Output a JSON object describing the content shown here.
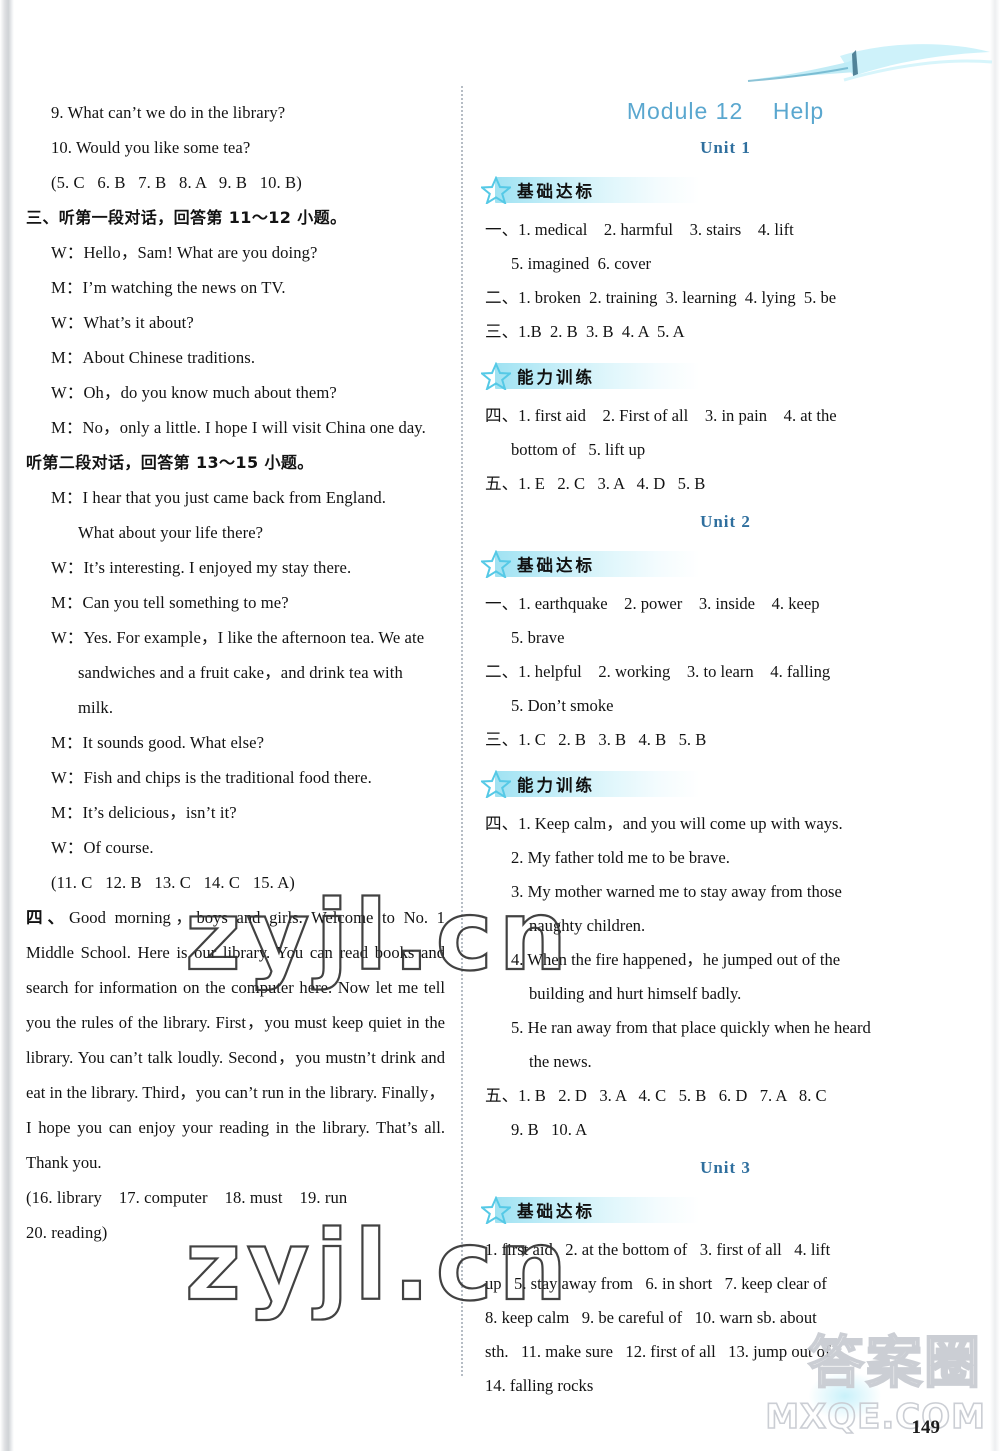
{
  "page": {
    "number": "149",
    "watermarks": {
      "site_outline": "zyjl.cn",
      "brand_cn": "答案圈",
      "brand_domain": "MXQE.COM"
    }
  },
  "left_column": {
    "lines": [
      {
        "id": "l1",
        "indent": 1,
        "text": "9. What can’t we do in the library?"
      },
      {
        "id": "l2",
        "indent": 1,
        "text": "10. Would you like some tea?"
      },
      {
        "id": "l3",
        "indent": 1,
        "text": "(5. C   6. B   7. B   8. A   9. B   10. B)"
      },
      {
        "id": "l4",
        "indent": 0,
        "text": "三、听第一段对话，回答第 11～12 小题。",
        "cn": true
      },
      {
        "id": "l5",
        "indent": 1,
        "text": "W：Hello，Sam! What are you doing?"
      },
      {
        "id": "l6",
        "indent": 1,
        "text": "M：I’m watching the news on TV."
      },
      {
        "id": "l7",
        "indent": 1,
        "text": "W：What’s it about?"
      },
      {
        "id": "l8",
        "indent": 1,
        "text": "M：About Chinese traditions."
      },
      {
        "id": "l9",
        "indent": 1,
        "text": "W：Oh，do you know much about them?"
      },
      {
        "id": "l10",
        "indent": 1,
        "text": "M：No，only a little. I hope I will visit China one day."
      },
      {
        "id": "l11",
        "indent": 0,
        "text": "听第二段对话，回答第 13～15 小题。",
        "cn": true
      },
      {
        "id": "l12",
        "indent": 1,
        "text": "M：I hear that you just came back from England."
      },
      {
        "id": "l13",
        "indent": 2,
        "text": "What about your life there?"
      },
      {
        "id": "l14",
        "indent": 1,
        "text": "W：It’s interesting. I enjoyed my stay there."
      },
      {
        "id": "l15",
        "indent": 1,
        "text": "M：Can you tell something to me?"
      },
      {
        "id": "l16",
        "indent": 1,
        "text": "W：Yes. For example，I like the afternoon tea. We ate"
      },
      {
        "id": "l17",
        "indent": 2,
        "text": "sandwiches and a fruit cake，and drink tea with"
      },
      {
        "id": "l18",
        "indent": 2,
        "text": "milk."
      },
      {
        "id": "l19",
        "indent": 1,
        "text": "M：It sounds good. What else?"
      },
      {
        "id": "l20",
        "indent": 1,
        "text": "W：Fish and chips is the traditional food there."
      },
      {
        "id": "l21",
        "indent": 1,
        "text": "M：It’s delicious，isn’t it?"
      },
      {
        "id": "l22",
        "indent": 1,
        "text": "W：Of course."
      },
      {
        "id": "l23",
        "indent": 1,
        "text": "(11. C   12. B   13. C   14. C   15. A)"
      }
    ],
    "paragraph_lead": "四、",
    "paragraph_text": "Good morning，boys and girls. Welcome to No. 1 Middle School. Here is our library. You can read books and search for information on the computer here. Now let me tell you the rules of the library. First，you must keep quiet in the library. You can’t talk loudly. Second，you mustn’t drink and eat in the library. Third，you can’t run in the library. Finally，I hope you can enjoy your reading in the library. That’s all. Thank you.",
    "answer_lines": [
      {
        "id": "a1",
        "text": "(16. library    17. computer    18. must    19. run"
      },
      {
        "id": "a2",
        "text": "20. reading)"
      }
    ]
  },
  "right_column": {
    "module_title": "Module 12    Help",
    "badges": {
      "basic": "基础达标",
      "ability": "能力训练"
    },
    "units": [
      {
        "id": "unit-1",
        "title": "Unit 1",
        "sections": [
          {
            "badge": "基础达标",
            "badge_kind": "basic",
            "lines": [
              {
                "id": "u1b1",
                "text": "一、1. medical    2. harmful    3. stairs    4. lift",
                "hang": false
              },
              {
                "id": "u1b2",
                "text": "5. imagined  6. cover",
                "hang": true
              },
              {
                "id": "u1b3",
                "text": "二、1. broken  2. training  3. learning  4. lying  5. be",
                "hang": false
              },
              {
                "id": "u1b4",
                "text": "三、1.B  2. B  3. B  4. A  5. A",
                "hang": false
              }
            ]
          },
          {
            "badge": "能力训练",
            "badge_kind": "ability",
            "lines": [
              {
                "id": "u1a1",
                "text": "四、1. first aid    2. First of all    3. in pain    4. at the",
                "hang": false,
                "spread": true
              },
              {
                "id": "u1a2",
                "text": "bottom of   5. lift up",
                "hang": true
              },
              {
                "id": "u1a3",
                "text": "五、1. E   2. C   3. A   4. D   5. B",
                "hang": false
              }
            ]
          }
        ]
      },
      {
        "id": "unit-2",
        "title": "Unit 2",
        "sections": [
          {
            "badge": "基础达标",
            "badge_kind": "basic",
            "lines": [
              {
                "id": "u2b1",
                "text": "一、1. earthquake    2. power    3. inside    4. keep",
                "hang": false
              },
              {
                "id": "u2b2",
                "text": "5. brave",
                "hang": true
              },
              {
                "id": "u2b3",
                "text": "二、1. helpful    2. working    3. to learn    4. falling",
                "hang": false
              },
              {
                "id": "u2b4",
                "text": "5. Don’t smoke",
                "hang": true
              },
              {
                "id": "u2b5",
                "text": "三、1. C   2. B   3. B   4. B   5. B",
                "hang": false
              }
            ]
          },
          {
            "badge": "能力训练",
            "badge_kind": "ability",
            "lines": [
              {
                "id": "u2a1",
                "text": "四、1. Keep calm，and you will come up with ways.",
                "hang": false
              },
              {
                "id": "u2a2",
                "text": "2. My father told me to be brave.",
                "hang": true
              },
              {
                "id": "u2a3",
                "text": "3. My mother warned me to stay away from those",
                "hang": true,
                "spread": true
              },
              {
                "id": "u2a4",
                "text": "naughty children.",
                "hang": true,
                "extra_indent": true
              },
              {
                "id": "u2a5",
                "text": "4. When the fire happened，he jumped out of the",
                "hang": true,
                "spread": true
              },
              {
                "id": "u2a6",
                "text": "building and hurt himself badly.",
                "hang": true,
                "extra_indent": true
              },
              {
                "id": "u2a7",
                "text": "5. He ran away from that place quickly when he heard",
                "hang": true,
                "spread": true
              },
              {
                "id": "u2a8",
                "text": "the news.",
                "hang": true,
                "extra_indent": true
              },
              {
                "id": "u2a9",
                "text": "五、1. B   2. D   3. A   4. C   5. B   6. D   7. A   8. C",
                "hang": false
              },
              {
                "id": "u2a10",
                "text": "9. B   10. A",
                "hang": true
              }
            ]
          }
        ]
      },
      {
        "id": "unit-3",
        "title": "Unit 3",
        "sections": [
          {
            "badge": "基础达标",
            "badge_kind": "basic",
            "lines": [
              {
                "id": "u3b1",
                "text": "1. first aid   2. at the bottom of   3. first of all   4. lift",
                "hang": false,
                "spread": true
              },
              {
                "id": "u3b2",
                "text": "up   5. stay away from   6. in short   7. keep clear of",
                "hang": false,
                "spread": true
              },
              {
                "id": "u3b3",
                "text": "8. keep calm   9. be careful of   10. warn sb. about",
                "hang": false,
                "spread": true
              },
              {
                "id": "u3b4",
                "text": "sth.   11. make sure   12. first of all   13. jump out of",
                "hang": false,
                "spread": true
              },
              {
                "id": "u3b5",
                "text": "14. falling rocks",
                "hang": false
              }
            ]
          }
        ]
      }
    ]
  }
}
